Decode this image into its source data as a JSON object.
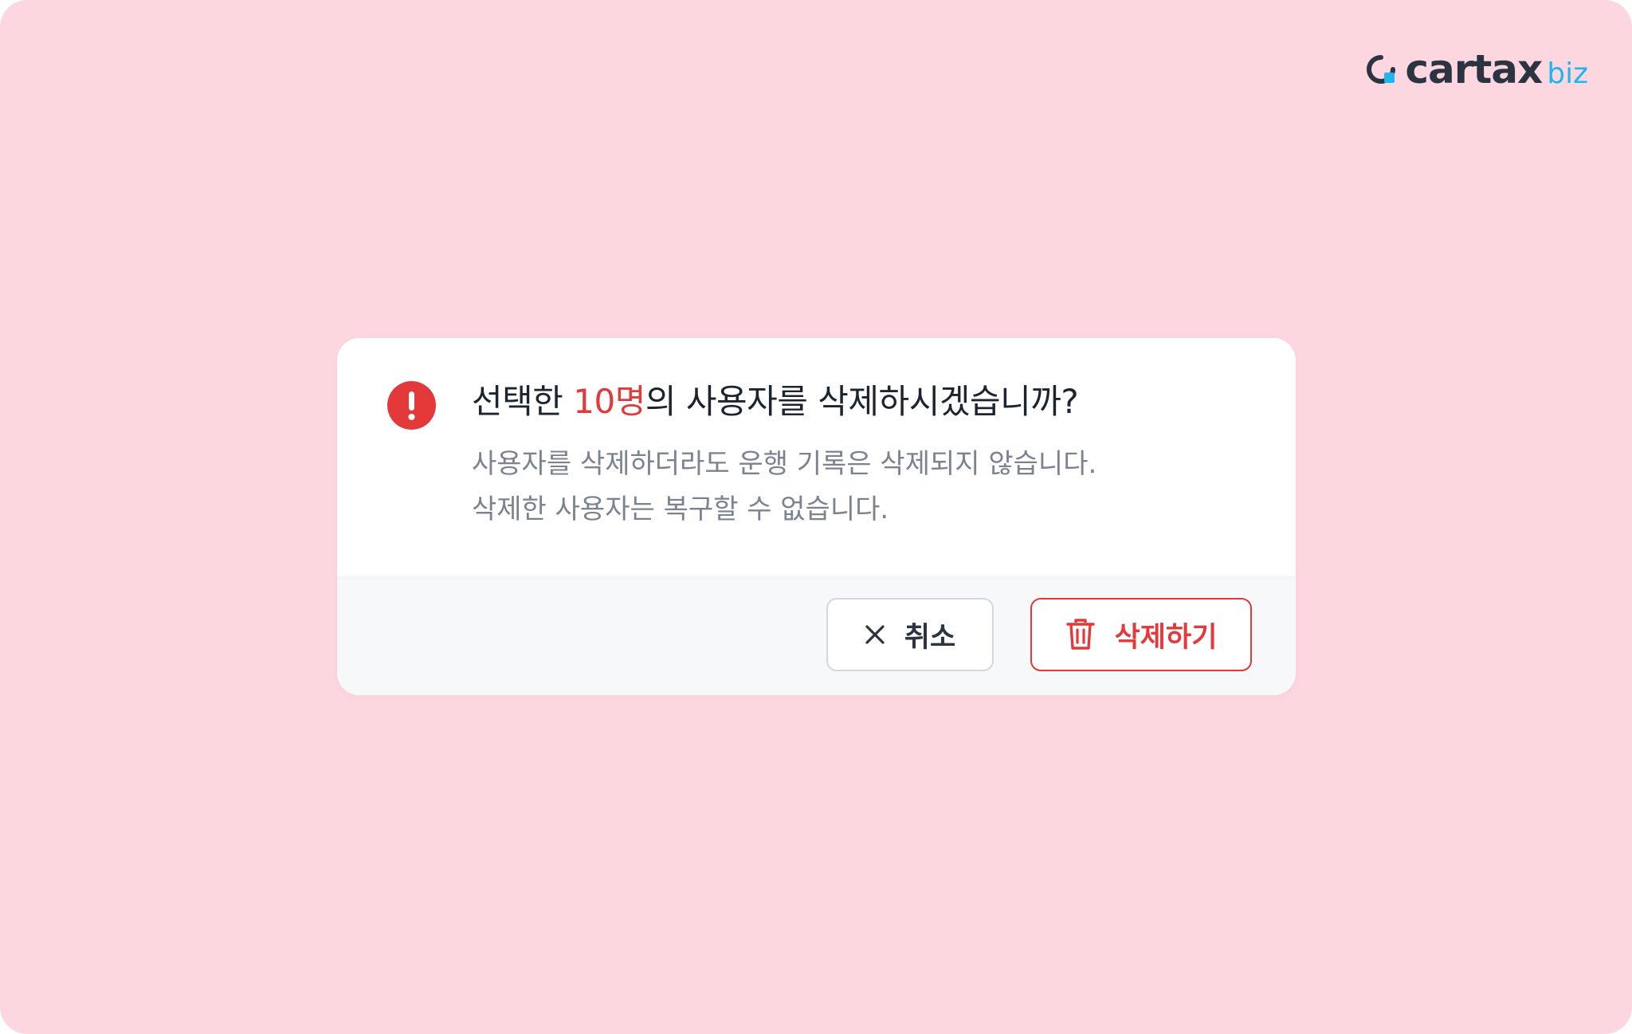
{
  "brand": {
    "logo_icon": "cartax-logo-mark",
    "name": "cartax",
    "suffix": "biz",
    "colors": {
      "wordmark": "#2b3440",
      "suffix": "#1fb6ef"
    }
  },
  "background_color": "#fdd7e0",
  "dialog": {
    "icon": "alert-circle-icon",
    "title_prefix": "선택한 ",
    "title_count": "10명",
    "title_suffix": "의 사용자를 삭제하시겠습니까?",
    "description": [
      "사용자를 삭제하더라도 운행 기록은 삭제되지 않습니다.",
      "삭제한 사용자는 복구할 수 없습니다."
    ],
    "buttons": {
      "cancel": {
        "label": "취소",
        "icon": "close-icon"
      },
      "delete": {
        "label": "삭제하기",
        "icon": "trash-icon"
      }
    },
    "colors": {
      "danger": "#e3393b",
      "footer_bg": "#f7f8fa"
    }
  }
}
